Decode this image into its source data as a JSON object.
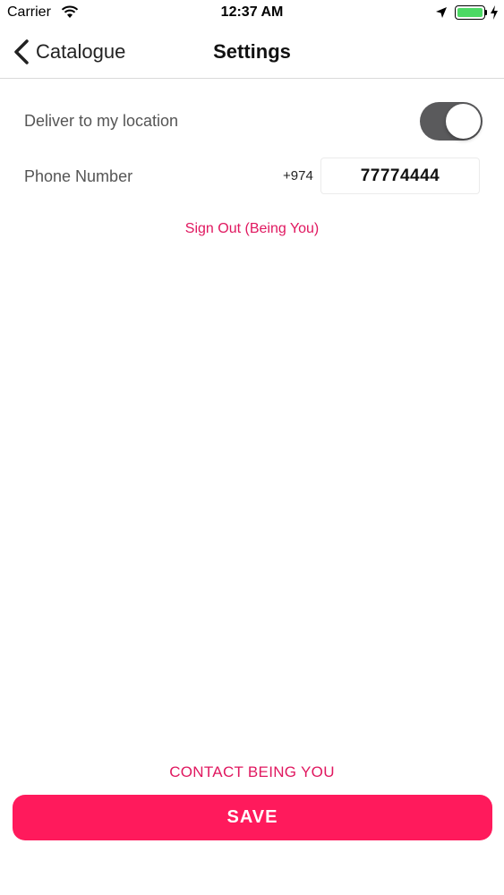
{
  "status_bar": {
    "carrier": "Carrier",
    "time": "12:37 AM",
    "battery_level": 1.0,
    "icons": [
      "wifi-icon",
      "location-arrow-icon",
      "battery-icon",
      "charging-bolt-icon"
    ]
  },
  "nav": {
    "back_label": "Catalogue",
    "title": "Settings",
    "back_icon": "chevron-left-icon"
  },
  "settings": {
    "deliver_label": "Deliver to my location",
    "deliver_enabled": true,
    "phone_label": "Phone Number",
    "country_code": "+974",
    "phone_value": "77774444",
    "sign_out_label": "Sign Out (Being You)"
  },
  "footer": {
    "contact_label": "CONTACT BEING YOU",
    "save_label": "SAVE"
  },
  "colors": {
    "accent": "#e0175f",
    "save_button": "#ff1a5c",
    "toggle_on": "#5a5a5c",
    "battery": "#4cd964"
  }
}
